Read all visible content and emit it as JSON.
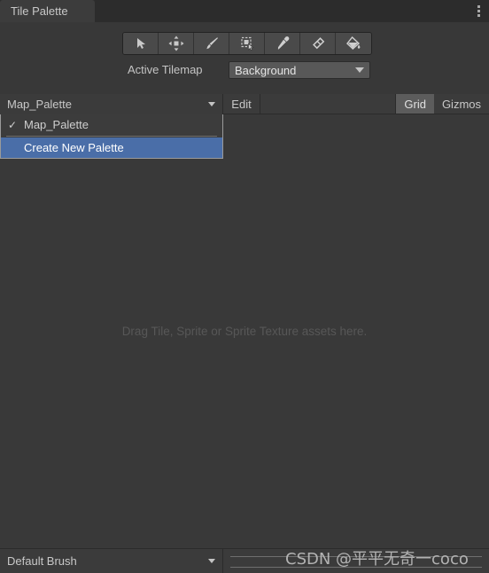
{
  "window": {
    "tab_label": "Tile Palette",
    "menu_icon": "kebab-menu-icon"
  },
  "toolbar": {
    "tools": [
      {
        "name": "select-tool",
        "icon": "cursor-arrow-icon",
        "active": false
      },
      {
        "name": "move-tool",
        "icon": "move-arrows-icon",
        "active": false
      },
      {
        "name": "paint-tool",
        "icon": "paintbrush-icon",
        "active": false
      },
      {
        "name": "box-fill-tool",
        "icon": "box-select-icon",
        "active": false
      },
      {
        "name": "picker-tool",
        "icon": "eyedropper-icon",
        "active": false
      },
      {
        "name": "erase-tool",
        "icon": "eraser-icon",
        "active": false
      },
      {
        "name": "fill-tool",
        "icon": "paint-bucket-icon",
        "active": false
      }
    ]
  },
  "active_tilemap": {
    "label": "Active Tilemap",
    "value": "Background"
  },
  "palette_bar": {
    "palette_value": "Map_Palette",
    "edit_label": "Edit",
    "grid_label": "Grid",
    "grid_active": true,
    "gizmos_label": "Gizmos",
    "gizmos_active": false
  },
  "palette_dropdown": {
    "open": true,
    "items": [
      {
        "label": "Map_Palette",
        "checked": true,
        "selected": false,
        "check_glyph": "✓"
      },
      {
        "label": "Create New Palette",
        "checked": false,
        "selected": true,
        "check_glyph": ""
      }
    ]
  },
  "canvas": {
    "drop_hint": "Drag Tile, Sprite or Sprite Texture assets here."
  },
  "bottom_bar": {
    "brush_value": "Default Brush"
  },
  "watermark": {
    "text": "CSDN @平平无奇一coco"
  },
  "colors": {
    "window_bg": "#393939",
    "tabbar_bg": "#2c2c2c",
    "tab_bg": "#3c3c3c",
    "toolbar_bg": "#383838",
    "row_bg": "#3b3b3b",
    "selection_blue": "#4a6ea8",
    "toggle_active": "#5c5c5c",
    "text": "#c8c8c8",
    "hint_text": "#575757",
    "popup_border": "#9a9a9a"
  }
}
